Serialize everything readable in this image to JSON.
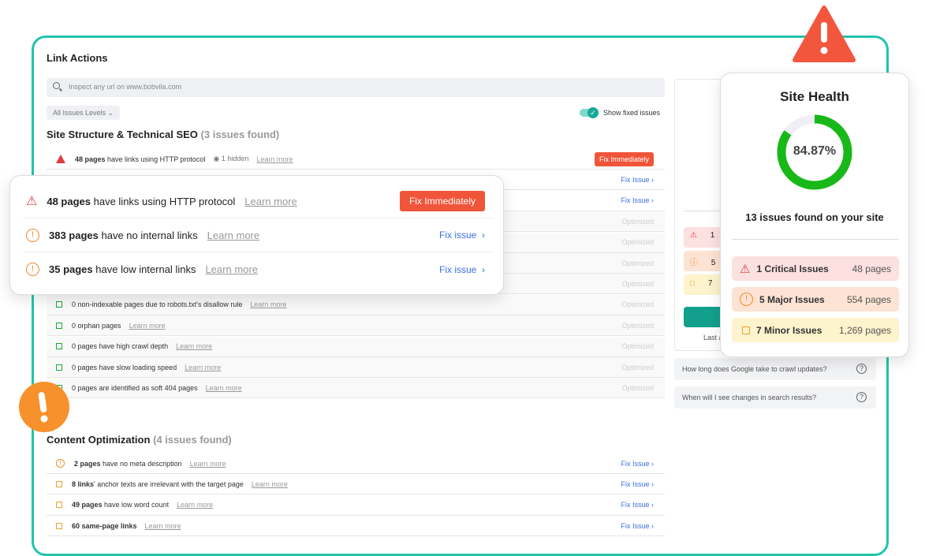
{
  "header": {
    "title": "Link Actions"
  },
  "search": {
    "placeholder": "Inspect any url on www.bobvila.com"
  },
  "filter": {
    "label": "All Issues Levels"
  },
  "toggle": {
    "label": "Show fixed issues",
    "on": true
  },
  "section1": {
    "title": "Site Structure & Technical SEO",
    "count": "(3 issues found)",
    "rows": [
      {
        "bold": "48 pages",
        "text": " have links using HTTP protocol",
        "hidden": "1 hidden",
        "learn": "Learn more",
        "action": "Fix Immediately",
        "level": "critical"
      },
      {
        "action": "Fix Issue"
      },
      {
        "action": "Fix Issue"
      },
      {
        "action": "Optimized"
      },
      {
        "action": "Optimized"
      },
      {
        "action": "Optimized"
      },
      {
        "action": "Optimized"
      },
      {
        "text": "0 non-indexable pages due to robots.txt's disallow rule",
        "learn": "Learn more",
        "action": "Optimized"
      },
      {
        "text": "0 orphan pages",
        "learn": "Learn more",
        "action": "Optimized"
      },
      {
        "text": "0 pages have high crawl depth",
        "learn": "Learn more",
        "action": "Optimized"
      },
      {
        "text": "0 pages have slow loading speed",
        "learn": "Learn more",
        "action": "Optimized"
      },
      {
        "text": "0 pages are identified as soft 404 pages",
        "learn": "Learn more",
        "action": "Optimized"
      }
    ]
  },
  "section2": {
    "title": "Content Optimization",
    "count": "(4 issues found)",
    "rows": [
      {
        "bold": "2 pages",
        "text": " have no meta description",
        "learn": "Learn more",
        "action": "Fix Issue"
      },
      {
        "bold": "8 links",
        "text": "' anchor texts are irrelevant with the target page",
        "learn": "Learn more",
        "action": "Fix Issue"
      },
      {
        "bold": "49 pages",
        "text": " have low word count",
        "learn": "Learn more",
        "action": "Fix Issue"
      },
      {
        "bold": "60 same-page links",
        "text": "",
        "learn": "Learn more",
        "action": "Fix Issue"
      }
    ]
  },
  "overlay": {
    "rows": [
      {
        "bold": "48 pages",
        "text": " have links using HTTP protocol",
        "learn": "Learn more",
        "action": "Fix Immediately"
      },
      {
        "bold": "383 pages",
        "text": " have no internal links",
        "learn": "Learn more",
        "action": "Fix issue"
      },
      {
        "bold": "35 pages",
        "text": " have low internal links",
        "learn": "Learn more",
        "action": "Fix issue"
      }
    ]
  },
  "side": {
    "partial": [
      "1",
      "5",
      "7"
    ],
    "last": "Last a",
    "faq": [
      "How long does Google take to crawl updates?",
      "When will I see changes in search results?"
    ]
  },
  "health": {
    "title": "Site Health",
    "score": "84.87%",
    "score_value": 84.87,
    "summary": "13 issues found on your site",
    "levels": [
      {
        "label": "1 Critical Issues",
        "pages": "48 pages",
        "bg": "#fde0e0"
      },
      {
        "label": "5 Major Issues",
        "pages": "554 pages",
        "bg": "#fde3d3"
      },
      {
        "label": "7 Minor Issues",
        "pages": "1,269 pages",
        "bg": "#fdf3cc"
      }
    ]
  },
  "colors": {
    "accent": "#22c4ad",
    "critical": "#f0553a",
    "link": "#3b6fe0",
    "ring": "#18b818"
  }
}
